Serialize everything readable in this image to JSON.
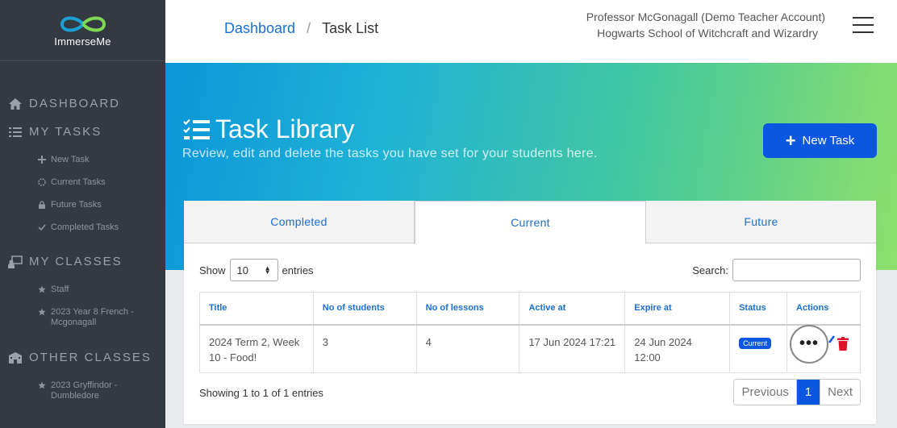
{
  "brand": {
    "name": "ImmerseMe",
    "colors": {
      "infinity_left": "#1ba0d6",
      "infinity_right": "#7ed957"
    }
  },
  "sidebar": {
    "dashboard": {
      "label": "DASHBOARD",
      "icon": "home-icon"
    },
    "my_tasks": {
      "label": "MY TASKS",
      "icon": "task-list-icon",
      "items": [
        {
          "label": "New Task",
          "icon": "plus-icon"
        },
        {
          "label": "Current Tasks",
          "icon": "spinner-icon"
        },
        {
          "label": "Future Tasks",
          "icon": "lock-icon"
        },
        {
          "label": "Completed Tasks",
          "icon": "check-icon"
        }
      ]
    },
    "my_classes": {
      "label": "MY CLASSES",
      "icon": "teacher-icon",
      "items": [
        {
          "label": "Staff",
          "icon": "star-icon"
        },
        {
          "label": "2023 Year 8 French - Mcgonagall",
          "icon": "star-icon"
        }
      ]
    },
    "other_classes": {
      "label": "OTHER CLASSES",
      "icon": "school-icon",
      "items": [
        {
          "label": "2023 Gryffindor - Dumbledore",
          "icon": "star-icon"
        }
      ]
    }
  },
  "header": {
    "breadcrumb": {
      "home": "Dashboard",
      "separator": "/",
      "current": "Task List"
    },
    "user": {
      "name": "Professor McGonagall (Demo Teacher Account)",
      "school": "Hogwarts School of Witchcraft and Wizardry"
    },
    "menu_icon": "hamburger-icon"
  },
  "hero": {
    "title": "Task Library",
    "subtitle": "Review, edit and delete the tasks you have set for your students here.",
    "new_task_label": "New Task",
    "colors": {
      "gradient_start": "#0b96d8",
      "gradient_end": "#8ee06a",
      "button": "#0b57e0"
    }
  },
  "tabs": [
    {
      "label": "Completed",
      "active": false
    },
    {
      "label": "Current",
      "active": true
    },
    {
      "label": "Future",
      "active": false
    }
  ],
  "table_controls": {
    "show_label": "Show",
    "entries_value": "10",
    "entries_label": "entries",
    "search_label": "Search:",
    "search_value": ""
  },
  "table": {
    "columns": [
      "Title",
      "No of students",
      "No of lessons",
      "Active at",
      "Expire at",
      "Status",
      "Actions"
    ],
    "rows": [
      {
        "title": "2024 Term 2, Week 10 - Food!",
        "students": "3",
        "lessons": "4",
        "active_at": "17 Jun 2024 17:21",
        "expire_at": "24 Jun 2024 12:00",
        "status": "Current"
      }
    ]
  },
  "footer": {
    "info": "Showing 1 to 1 of 1 entries",
    "pagination": {
      "previous": "Previous",
      "current_page": "1",
      "next": "Next"
    }
  }
}
